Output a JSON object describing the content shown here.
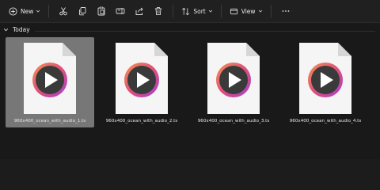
{
  "toolbar": {
    "new_label": "New",
    "sort_label": "Sort",
    "view_label": "View",
    "icons": [
      "add-icon",
      "cut-icon",
      "copy-icon",
      "paste-icon",
      "rename-icon",
      "share-icon",
      "delete-icon",
      "sort-icon",
      "view-icon",
      "more-icon"
    ]
  },
  "group": {
    "label": "Today"
  },
  "files": [
    {
      "name": "960x400_ocean_with_audio_1.ts",
      "selected": true
    },
    {
      "name": "960x400_ocean_with_audio_2.ts",
      "selected": false
    },
    {
      "name": "960x400_ocean_with_audio_3.ts",
      "selected": false
    },
    {
      "name": "960x400_ocean_with_audio_4.ts",
      "selected": false
    }
  ],
  "colors": {
    "background": "#191919",
    "toolbar": "#202020",
    "selection": "#777777",
    "ring_orange": "#f0824a",
    "ring_purple": "#b040c8"
  }
}
